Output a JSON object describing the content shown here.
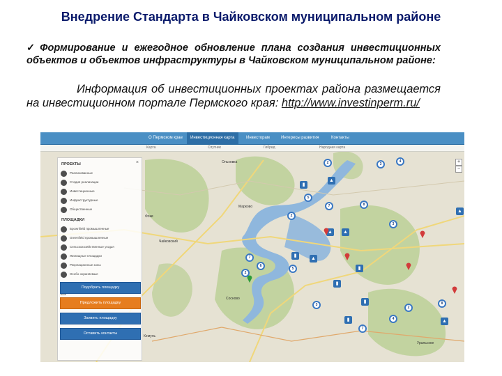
{
  "slide": {
    "title": "Внедрение Стандарта в Чайковском муниципальном районе",
    "bullet_mark": "✓",
    "bullet_text": "Формирование и ежегодное обновление плана создания инвестиционных объектов и объектов инфраструктуры в Чайковском муниципальном районе:",
    "info_text": "Информация об инвестиционных проектах района размещается на инвестиционном портале Пермского края: ",
    "link_text": "http://www.investinperm.ru/"
  },
  "map": {
    "nav": [
      {
        "label": "О Пермском крае",
        "active": false
      },
      {
        "label": "Инвестиционная карта",
        "active": true
      },
      {
        "label": "Инвесторам",
        "active": false
      },
      {
        "label": "Интересы развития",
        "active": false
      },
      {
        "label": "Контакты",
        "active": false
      }
    ],
    "sub_nav": [
      "Карта",
      "Спутник",
      "Гибрид",
      "Народная карта"
    ],
    "panel": {
      "projects_heading": "ПРОЕКТЫ",
      "projects": [
        "Реализованные",
        "Стадия реализации",
        "Инвестиционные",
        "Инфраструктурные",
        "Общественные"
      ],
      "platforms_heading": "ПЛОЩАДКИ",
      "platforms": [
        "Брownfield промышленные",
        "Greenfield промышленные",
        "Сельскохозяйственные угодья",
        "Жилищные площадки",
        "Рекреационные зоны",
        "Особо охраняемые"
      ],
      "checkbox_label": "Показать все"
    },
    "buttons": [
      {
        "label": "Подобрать площадку",
        "style": "blue"
      },
      {
        "label": "Предложить площадку",
        "style": "orange"
      },
      {
        "label": "Заявить площадку",
        "style": "blue"
      },
      {
        "label": "Оставить контакты",
        "style": "blue"
      }
    ],
    "towns": [
      "Фоки",
      "Ольховка",
      "Чайковский",
      "Марково",
      "Сосново",
      "Кемуль",
      "Уральское"
    ],
    "markers": [
      "2",
      "3",
      "4",
      "5",
      "7",
      "8",
      "2",
      "3",
      "7",
      "6",
      "5",
      "3",
      "2",
      "8",
      "4",
      "7",
      "2"
    ],
    "zoom_in": "+",
    "zoom_out": "−",
    "colors": {
      "water": "#8fb7dd",
      "forest": "#b9cf94",
      "field": "#e6e2d3",
      "road": "#f0d77a",
      "nav": "#4a8fc4",
      "marker": "#3a78c3"
    }
  }
}
